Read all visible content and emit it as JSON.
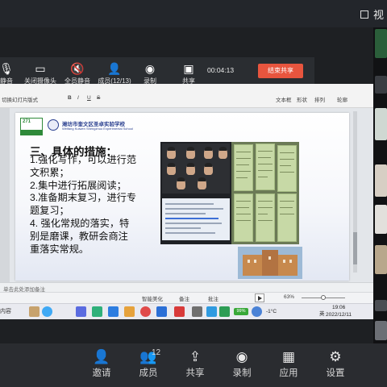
{
  "outer": {
    "title": "视",
    "bottom_bar": [
      {
        "label": "邀请",
        "icon": "add-user-icon",
        "glyph": "👤"
      },
      {
        "label": "成员",
        "icon": "members-icon",
        "glyph": "👥",
        "count": "12"
      },
      {
        "label": "共享",
        "icon": "share-icon",
        "glyph": "⇪"
      },
      {
        "label": "录制",
        "icon": "record-icon",
        "glyph": "◉"
      },
      {
        "label": "应用",
        "icon": "apps-icon",
        "glyph": "▦"
      },
      {
        "label": "设置",
        "icon": "gear-icon",
        "glyph": "⚙"
      }
    ]
  },
  "meeting_toolbar": {
    "items": [
      {
        "label": "静音",
        "icon": "mic-icon",
        "glyph": "🎙"
      },
      {
        "label": "关闭摄像头",
        "icon": "camera-icon",
        "glyph": "▭"
      },
      {
        "label": "全员静音",
        "icon": "mute-all-icon",
        "glyph": "🔇"
      },
      {
        "label": "成员(12/13)",
        "icon": "members-icon",
        "glyph": "👤"
      },
      {
        "label": "录制",
        "icon": "record-icon",
        "glyph": "◉"
      },
      {
        "label": "共享",
        "icon": "share-screen-icon",
        "glyph": "▣"
      }
    ],
    "timer": "00:04:13",
    "end_share": "结束共享"
  },
  "wps": {
    "ribbon_row1": [
      "切换幻灯片",
      "版式",
      "B",
      "I",
      "U",
      "S"
    ],
    "ribbon_row2": [
      "切换幻灯片",
      "版式"
    ],
    "right_items": [
      "文本框",
      "形状",
      "排列",
      "轮廓"
    ],
    "dark_panel_label": "显示"
  },
  "slide": {
    "school_cn": "潍坊市奎文区圣卓实验学校",
    "school_en": "Weifang Kuiwen Shengzhuo Experimental School",
    "logo_number": "271",
    "heading": "三、具体的措施：",
    "body_lines": [
      "1.强化写作，可以进行范",
      "文积累；",
      "2.集中进行拓展阅读；",
      "3.准备期末复习，进行专",
      "题复习；",
      "4. 强化常规的落实，特",
      "别是磨课，教研会商注",
      "重落实常规。"
    ]
  },
  "notes_placeholder": "单击此处添加备注",
  "status_bar": {
    "smart": "智能美化",
    "notes": "备注",
    "comment": "批注",
    "zoom": "63%"
  },
  "taskbar": {
    "search": "内容",
    "temp": "-1°C",
    "badge": "99%",
    "lang": "英",
    "time": "19:06",
    "date": "2022/12/11"
  }
}
